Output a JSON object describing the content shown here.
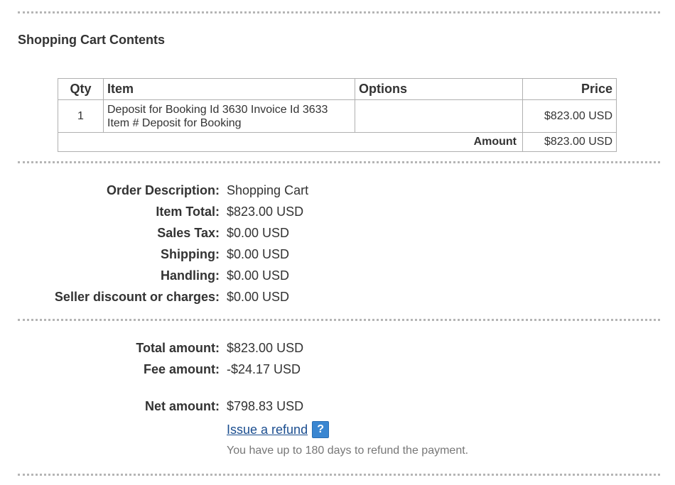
{
  "cart": {
    "title": "Shopping Cart Contents",
    "columns": {
      "qty": "Qty",
      "item": "Item",
      "options": "Options",
      "price": "Price"
    },
    "rows": [
      {
        "qty": "1",
        "item_line1": "Deposit for Booking Id 3630 Invoice Id 3633",
        "item_line2": "Item # Deposit for Booking",
        "options": "",
        "price": "$823.00 USD"
      }
    ],
    "amount_label": "Amount",
    "amount_value": "$823.00 USD"
  },
  "summary": {
    "order_description": {
      "label": "Order Description:",
      "value": "Shopping Cart"
    },
    "item_total": {
      "label": "Item Total:",
      "value": "$823.00 USD"
    },
    "sales_tax": {
      "label": "Sales Tax:",
      "value": "$0.00 USD"
    },
    "shipping": {
      "label": "Shipping:",
      "value": "$0.00 USD"
    },
    "handling": {
      "label": "Handling:",
      "value": "$0.00 USD"
    },
    "seller_discount": {
      "label": "Seller discount or charges:",
      "value": "$0.00 USD"
    }
  },
  "totals": {
    "total_amount": {
      "label": "Total amount:",
      "value": "$823.00 USD"
    },
    "fee_amount": {
      "label": "Fee amount:",
      "value": "-$24.17 USD"
    },
    "net_amount": {
      "label": "Net amount:",
      "value": "$798.83 USD"
    }
  },
  "refund": {
    "link_label": "Issue a refund",
    "help_icon": "?",
    "note": "You have up to 180 days to refund the payment."
  },
  "colors": {
    "link": "#1a4d8f",
    "help_icon_bg": "#3a86d1",
    "divider": "#b5b5b5"
  }
}
